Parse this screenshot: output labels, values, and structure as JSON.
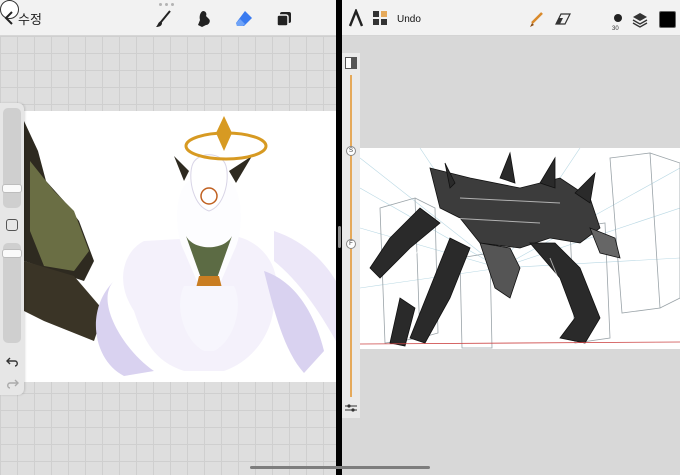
{
  "left_app": {
    "back_label": "수정",
    "tools": {
      "brush": "brush-icon",
      "smudge": "smudge-icon",
      "eraser": "eraser-icon",
      "layers": "layers-icon",
      "color": "color-icon"
    },
    "active_tool": "eraser",
    "accent_color": "#3a7bf0",
    "color_value": "#ffffff"
  },
  "right_app": {
    "undo_label": "Undo",
    "brush_size": "30",
    "slider_badges": {
      "size": "S",
      "flow": "F"
    },
    "color_value": "#000000",
    "accent_color": "#e5a95a"
  }
}
